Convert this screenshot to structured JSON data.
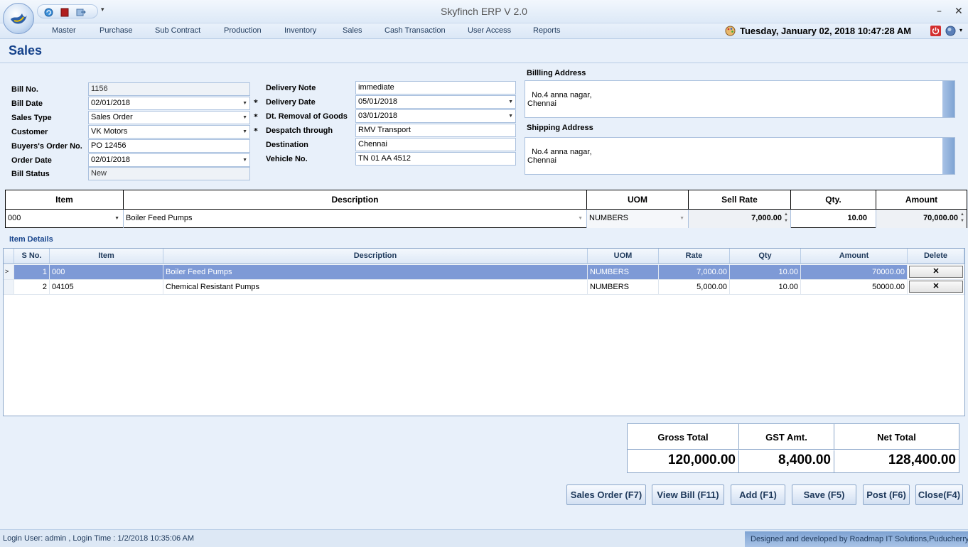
{
  "window": {
    "title": "Skyfinch  ERP V 2.0",
    "minimize": "–",
    "close": "✕"
  },
  "menu": [
    "Master",
    "Purchase",
    "Sub Contract",
    "Production",
    "Inventory",
    "Sales",
    "Cash Transaction",
    "User Access",
    "Reports"
  ],
  "datetime": "Tuesday, January 02, 2018 10:47:28 AM",
  "page": {
    "title": "Sales"
  },
  "form": {
    "bill_no_label": "Bill No.",
    "bill_no": "1156",
    "bill_date_label": "Bill Date",
    "bill_date": "02/01/2018",
    "sales_type_label": "Sales Type",
    "sales_type": "Sales Order",
    "customer_label": "Customer",
    "customer": "VK Motors",
    "buyers_order_label": "Buyers's Order No.",
    "buyers_order": "PO 12456",
    "order_date_label": "Order Date",
    "order_date": "02/01/2018",
    "bill_status_label": "Bill Status",
    "bill_status": "New",
    "delivery_note_label": "Delivery Note",
    "delivery_note": "immediate",
    "delivery_date_label": "Delivery Date",
    "delivery_date": "05/01/2018",
    "removal_label": "Dt. Removal of Goods",
    "removal_date": "03/01/2018",
    "despatch_label": "Despatch through",
    "despatch": "RMV Transport",
    "destination_label": "Destination",
    "destination": "Chennai",
    "vehicle_label": "Vehicle No.",
    "vehicle": "TN 01 AA 4512",
    "required_mark": "*",
    "billing_label": "Billling Address",
    "billing_address": "No.4 anna nagar,\nChennai",
    "shipping_label": "Shipping Address",
    "shipping_address": "No.4 anna nagar,\nChennai"
  },
  "entry": {
    "headers": [
      "Item",
      "Description",
      "UOM",
      "Sell Rate",
      "Qty.",
      "Amount"
    ],
    "item": "000",
    "description": "Boiler Feed Pumps",
    "uom": "NUMBERS",
    "sell_rate": "7,000.00",
    "qty": "10.00",
    "amount": "70,000.00"
  },
  "details": {
    "label": "Item Details",
    "headers": [
      "S No.",
      "Item",
      "Description",
      "UOM",
      "Rate",
      "Qty",
      "Amount",
      "Delete"
    ],
    "rows": [
      {
        "sno": "1",
        "item": "000",
        "description": "Boiler Feed Pumps",
        "uom": "NUMBERS",
        "rate": "7,000.00",
        "qty": "10.00",
        "amount": "70000.00",
        "delete": "✕"
      },
      {
        "sno": "2",
        "item": "04105",
        "description": "Chemical Resistant Pumps",
        "uom": "NUMBERS",
        "rate": "5,000.00",
        "qty": "10.00",
        "amount": "50000.00",
        "delete": "✕"
      }
    ]
  },
  "totals": {
    "gross_label": "Gross Total",
    "gross": "120,000.00",
    "gst_label": "GST Amt.",
    "gst": "8,400.00",
    "net_label": "Net Total",
    "net": "128,400.00"
  },
  "buttons": {
    "sales_order": "Sales Order (F7)",
    "view_bill": "View Bill (F11)",
    "add": "Add (F1)",
    "save": "Save (F5)",
    "post": "Post (F6)",
    "close": "Close(F4)"
  },
  "status": {
    "login": "Login User: admin , Login Time : 1/2/2018 10:35:06 AM",
    "credit": "Designed and developed by Roadmap IT Solutions,Puducherry"
  },
  "colors": {
    "accent": "#15428b",
    "selected_row": "#7e9ad6",
    "power": "#d32f2f"
  }
}
